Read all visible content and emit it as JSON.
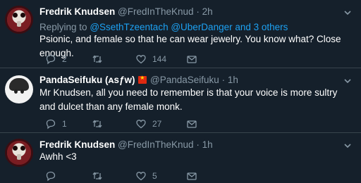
{
  "tweets": [
    {
      "name": "Fredrik Knudsen",
      "handle": "@FredInTheKnud",
      "time": "2h",
      "reply_prefix": "Replying to",
      "reply_user1": "@SsethTzeentach",
      "reply_user2": "@UberDanger",
      "reply_suffix": "and 3 others",
      "text": "Psionic, and female so that he can wear jewelry. You know what? Close enough.",
      "replies": "2",
      "retweets": "",
      "likes": "144"
    },
    {
      "name": "PandaSeifuku (ᴀѕƒᴡ)",
      "handle": "@PandaSeifuku",
      "time": "1h",
      "text": "Mr Knudsen, all you need to remember is that your voice is more sultry and dulcet than any female monk.",
      "replies": "1",
      "retweets": "",
      "likes": "27"
    },
    {
      "name": "Fredrik Knudsen",
      "handle": "@FredInTheKnud",
      "time": "1h",
      "text": "Awhh <3",
      "replies": "",
      "retweets": "",
      "likes": "5"
    }
  ],
  "separator": "·",
  "colors": {
    "background": "#15202b",
    "secondary_text": "#8899a6",
    "link": "#1da1f2",
    "divider": "#38444d"
  }
}
